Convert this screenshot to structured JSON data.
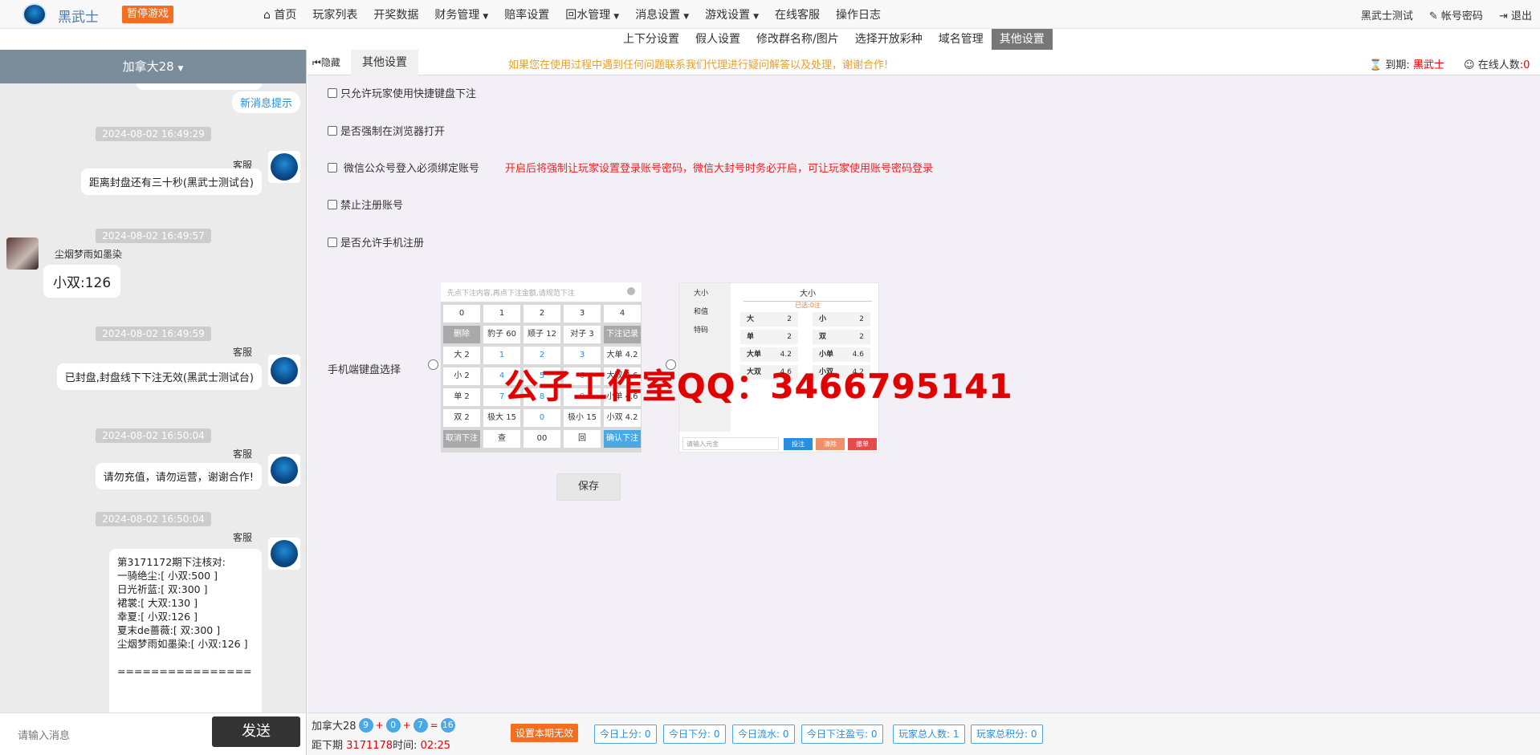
{
  "brand": {
    "name": "黑武士",
    "pause_label": "暂停游戏"
  },
  "nav": {
    "row1": [
      {
        "label": "首页",
        "icon": "home-icon"
      },
      {
        "label": "玩家列表"
      },
      {
        "label": "开奖数据"
      },
      {
        "label": "财务管理",
        "dropdown": true
      },
      {
        "label": "赔率设置"
      },
      {
        "label": "回水管理",
        "dropdown": true
      },
      {
        "label": "消息设置",
        "dropdown": true
      },
      {
        "label": "游戏设置",
        "dropdown": true
      },
      {
        "label": "在线客服"
      },
      {
        "label": "操作日志"
      }
    ],
    "row2": [
      "上下分设置",
      "假人设置",
      "修改群名称/图片",
      "选择开放彩种",
      "域名管理",
      "其他设置"
    ],
    "active_row2": "其他设置",
    "user": "黑武士测试",
    "account_password": "帐号密码",
    "logout": "退出"
  },
  "room": {
    "name": "加拿大28"
  },
  "chat": {
    "new_msg_label": "新消息提示",
    "messages": [
      {
        "time": "2024-08-02 16:49:29",
        "sender": "客服",
        "text": "距离封盘还有三十秒(黑武士测试台)"
      },
      {
        "time": "2024-08-02 16:49:57",
        "sender": "尘烟梦雨如墨染",
        "text": "小双:126"
      },
      {
        "time": "2024-08-02 16:49:59",
        "sender": "客服",
        "text": "已封盘,封盘线下下注无效(黑武士测试台)"
      },
      {
        "time": "2024-08-02 16:50:04",
        "sender": "客服",
        "text": "请勿充值，请勿运营，谢谢合作!"
      },
      {
        "time": "2024-08-02 16:50:04",
        "sender": "客服",
        "text": "第3171172期下注核对:\n一骑绝尘:[ 小双:500 ]\n日光祈蓝:[ 双:300 ]\n裙裳:[ 大双:130 ]\n幸夏:[ 小双:126 ]\n夏末de蔷薇:[ 双:300 ]\n尘烟梦雨如墨染:[ 小双:126 ]\n\n================"
      }
    ],
    "input_placeholder": "请输入消息",
    "send_label": "发送"
  },
  "subbar": {
    "hide_label": "隐藏",
    "tab": "其他设置",
    "notice": "如果您在使用过程中遇到任何问题联系我们代理进行疑问解答以及处理，谢谢合作!",
    "expire_label": "到期:",
    "expire_value": "黑武士",
    "online_label": "在线人数:",
    "online_value": "0"
  },
  "settings": {
    "quick_keyboard": "只允许玩家使用快捷键盘下注",
    "force_browser": "是否强制在浏览器打开",
    "wechat_bind": "微信公众号登入必须绑定账号",
    "wechat_bind_warning": "开启后将强制让玩家设置登录账号密码，微信大封号时务必开启，可让玩家使用账号密码登录",
    "disable_register": "禁止注册账号",
    "allow_phone_register": "是否允许手机注册",
    "keyboard_select_label": "手机端键盘选择",
    "save_label": "保存"
  },
  "keyboard1": {
    "input_hint": "先点下注内容,再点下注金额,请规范下注",
    "keys": [
      {
        "t": "0"
      },
      {
        "t": "1"
      },
      {
        "t": "2"
      },
      {
        "t": "3"
      },
      {
        "t": "4"
      },
      {
        "t": "删除",
        "k": "gray"
      },
      {
        "t": "豹子 60"
      },
      {
        "t": "顺子 12"
      },
      {
        "t": "对子 3"
      },
      {
        "t": "下注记录",
        "k": "gray"
      },
      {
        "t": "大 2"
      },
      {
        "t": "1",
        "k": "t"
      },
      {
        "t": "2",
        "k": "t"
      },
      {
        "t": "3",
        "k": "t"
      },
      {
        "t": "大单 4.2"
      },
      {
        "t": "小 2"
      },
      {
        "t": "4",
        "k": "t"
      },
      {
        "t": "5",
        "k": "t"
      },
      {
        "t": "6",
        "k": "t"
      },
      {
        "t": "大双 4.6"
      },
      {
        "t": "单 2"
      },
      {
        "t": "7",
        "k": "t"
      },
      {
        "t": "8",
        "k": "t"
      },
      {
        "t": "9",
        "k": "t"
      },
      {
        "t": "小单 4.6"
      },
      {
        "t": "双 2"
      },
      {
        "t": "极大 15"
      },
      {
        "t": "0",
        "k": "t"
      },
      {
        "t": "极小 15"
      },
      {
        "t": "小双 4.2"
      },
      {
        "t": "取消下注",
        "k": "gray"
      },
      {
        "t": "查"
      },
      {
        "t": "00"
      },
      {
        "t": "回"
      },
      {
        "t": "确认下注",
        "k": "blue"
      }
    ]
  },
  "keyboard2": {
    "side": [
      "大小",
      "和值",
      "特码"
    ],
    "head": "大小",
    "sub": "已选:0注",
    "cells": [
      {
        "n": "大",
        "v": "2"
      },
      {
        "n": "小",
        "v": "2"
      },
      {
        "n": "单",
        "v": "2"
      },
      {
        "n": "双",
        "v": "2"
      },
      {
        "n": "大单",
        "v": "4.2"
      },
      {
        "n": "小单",
        "v": "4.6"
      },
      {
        "n": "大双",
        "v": "4.6"
      },
      {
        "n": "小双",
        "v": "4.2"
      }
    ],
    "input_hint": "请输入元金",
    "buttons": [
      {
        "t": "投注",
        "c": "#2a8ee0"
      },
      {
        "t": "清除",
        "c": "#f0906a"
      },
      {
        "t": "撤单",
        "c": "#e84a4a"
      }
    ]
  },
  "watermark": "公子工作室QQ：3466795141",
  "status": {
    "game": "加拿大28",
    "balls": [
      "9",
      "0",
      "7",
      "16"
    ],
    "period_label": "距下期",
    "period_value": "3171178",
    "time_label": "时间:",
    "time_value": "02:25",
    "invalid_label": "设置本期无效",
    "stats": [
      "今日上分: 0",
      "今日下分: 0",
      "今日流水: 0",
      "今日下注盈亏: 0",
      "玩家总人数: 1",
      "玩家总积分: 0"
    ]
  }
}
